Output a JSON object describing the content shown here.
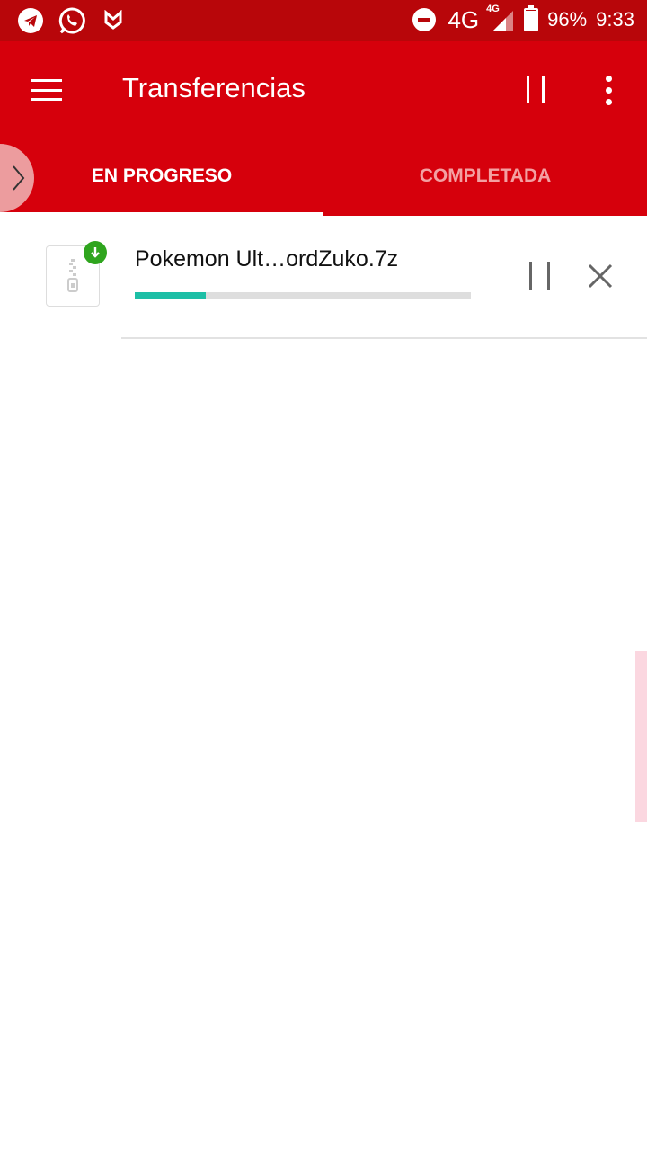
{
  "status_bar": {
    "network": "4G",
    "network_small": "4G",
    "battery": "96%",
    "battery_level": 0.96,
    "time": "9:33",
    "left_icons": [
      "telegram-icon",
      "whatsapp-icon",
      "gmail-icon"
    ],
    "right_icons": [
      "do-not-disturb-icon",
      "signal-icon",
      "battery-icon"
    ]
  },
  "app_bar": {
    "title": "Transferencias",
    "background": "#d6000c",
    "icons": [
      "menu-icon",
      "pause-all-icon",
      "more-vert-icon"
    ]
  },
  "tabs": [
    {
      "label": "EN PROGRESO",
      "active": true
    },
    {
      "label": "COMPLETADA",
      "active": false
    }
  ],
  "transfers": [
    {
      "file_name": "Pokemon Ult…ordZuko.7z",
      "progress": 0.21,
      "progress_color": "#1dbfa6",
      "badge_color": "#2fa51e"
    }
  ]
}
